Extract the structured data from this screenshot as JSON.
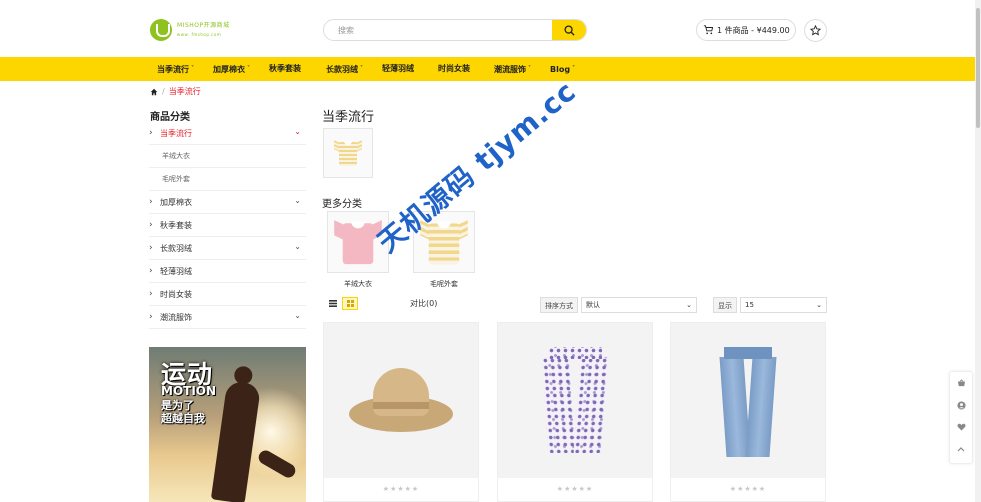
{
  "header": {
    "logo_name": "MISHOP开源商城",
    "logo_url": "www.  fmshop.com",
    "search_placeholder": "搜索",
    "cart_text": "1 件商品 - ¥449.00"
  },
  "nav": [
    {
      "label": "当季流行",
      "caret": "˅"
    },
    {
      "label": "加厚棉衣",
      "caret": "˅"
    },
    {
      "label": "秋季套装",
      "caret": ""
    },
    {
      "label": "长款羽绒",
      "caret": "˅"
    },
    {
      "label": "轻薄羽绒",
      "caret": ""
    },
    {
      "label": "时尚女装",
      "caret": ""
    },
    {
      "label": "潮流服饰",
      "caret": "˅"
    },
    {
      "label": "Blog",
      "caret": "˅"
    }
  ],
  "breadcrumb": {
    "home_icon": "home-icon",
    "sep": "/",
    "current": "当季流行"
  },
  "sidebar": {
    "title": "商品分类",
    "categories": [
      {
        "label": "当季流行",
        "expandable": true,
        "active": true
      },
      {
        "label": "羊绒大衣",
        "sub": true
      },
      {
        "label": "毛呢外套",
        "sub": true
      },
      {
        "label": "加厚棉衣",
        "expandable": true
      },
      {
        "label": "秋季套装",
        "expandable": false
      },
      {
        "label": "长款羽绒",
        "expandable": true
      },
      {
        "label": "轻薄羽绒",
        "expandable": false
      },
      {
        "label": "时尚女装",
        "expandable": false
      },
      {
        "label": "潮流服饰",
        "expandable": true
      }
    ],
    "banner": {
      "line1": "运动",
      "line2": "MOTION",
      "line3": "是为了",
      "line4": "超越自我"
    }
  },
  "main": {
    "title": "当季流行",
    "more_title": "更多分类",
    "subcategories": [
      {
        "label": "羊绒大衣"
      },
      {
        "label": "毛呢外套"
      }
    ],
    "toolbar": {
      "compare": "对比(0)",
      "sort_label": "排序方式",
      "sort_value": "默认",
      "show_label": "显示",
      "show_value": "15"
    },
    "products": [
      {
        "image": "straw-hat",
        "rating": "★★★★★"
      },
      {
        "image": "floral-pants",
        "rating": "★★★★★"
      },
      {
        "image": "denim-jeans",
        "rating": "★★★★★"
      }
    ]
  },
  "watermark": "天机源码 tjym.cc",
  "colors": {
    "accent": "#fdd600",
    "active": "#e6212a",
    "logo": "#8dc21f",
    "watermark": "#1f62c8"
  }
}
